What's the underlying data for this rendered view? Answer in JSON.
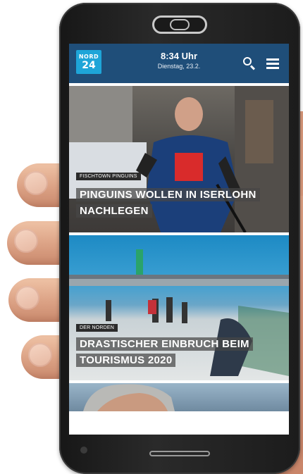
{
  "status": {
    "time": "8:34 Uhr",
    "date": "Dienstag, 23.2."
  },
  "brand": {
    "line1": "NORD",
    "line2": "24",
    "color": "#1ea5d8"
  },
  "header": {
    "background": "#1f4e79",
    "icons": [
      "search-icon",
      "menu-icon"
    ]
  },
  "articles": [
    {
      "category": "FISCHTOWN PINGUINS",
      "headline": "PINGUINS WOLLEN IN ISERLOHN NACHLEGEN"
    },
    {
      "category": "DER NORDEN",
      "headline": "DRASTISCHER EINBRUCH BEIM TOURISMUS 2020"
    }
  ]
}
